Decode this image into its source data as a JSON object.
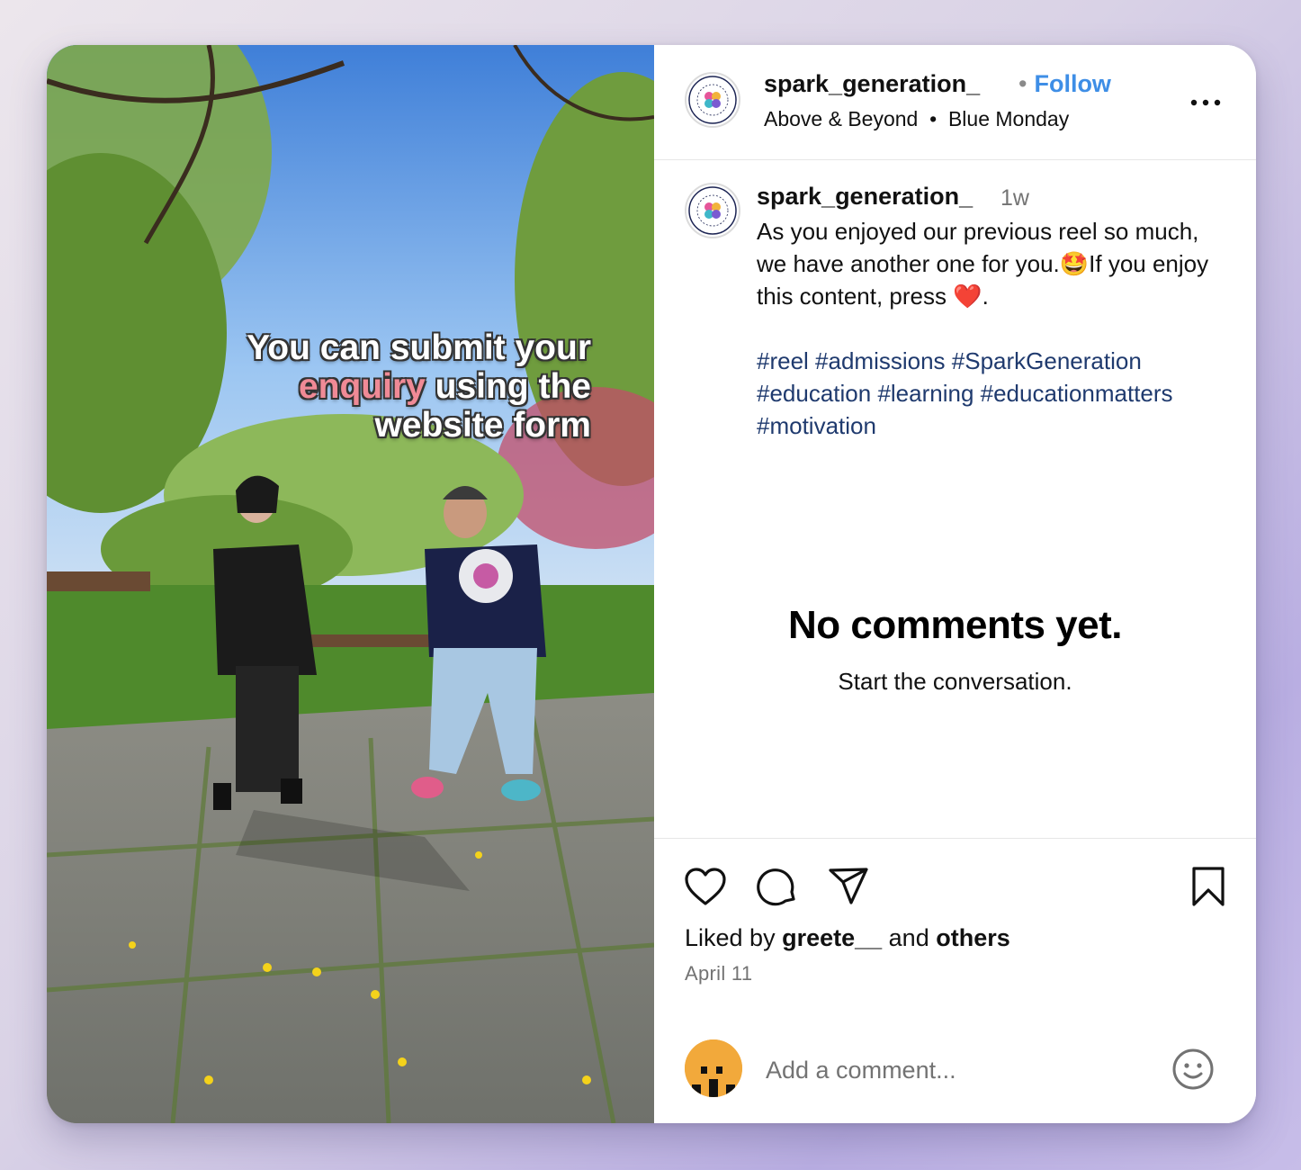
{
  "media": {
    "overlay_line1": "You can submit your",
    "overlay_line2_highlight": "enquiry",
    "overlay_line2_rest": " using the",
    "overlay_line3": "website form"
  },
  "header": {
    "username": "spark_generation_",
    "follow_label": "Follow",
    "separator": "•",
    "audio_artist": "Above & Beyond",
    "audio_separator": "•",
    "audio_track": "Blue Monday",
    "more_icon": "more-horizontal-icon"
  },
  "caption": {
    "username": "spark_generation_",
    "time": "1w",
    "text": "As you enjoyed our previous reel so much, we have another one for you.🤩If you enjoy this content, press ❤️.",
    "hashtags": "#reel #admissions #SparkGeneration #education #learning #educationmatters #motivation"
  },
  "comments": {
    "empty_title": "No comments yet.",
    "empty_subtitle": "Start the conversation."
  },
  "actions": {
    "like_icon": "heart-icon",
    "comment_icon": "comment-icon",
    "share_icon": "send-icon",
    "save_icon": "bookmark-icon"
  },
  "likes": {
    "prefix": "Liked by ",
    "user": "greete__",
    "middle": " and ",
    "others": "others"
  },
  "date": "April 11",
  "comment_box": {
    "placeholder": "Add a comment...",
    "emoji_icon": "smiley-icon"
  },
  "colors": {
    "follow": "#3e8ee6",
    "hashtag": "#1f3a6e",
    "overlay_highlight": "#f08a96",
    "user_avatar": "#f2a93b"
  }
}
